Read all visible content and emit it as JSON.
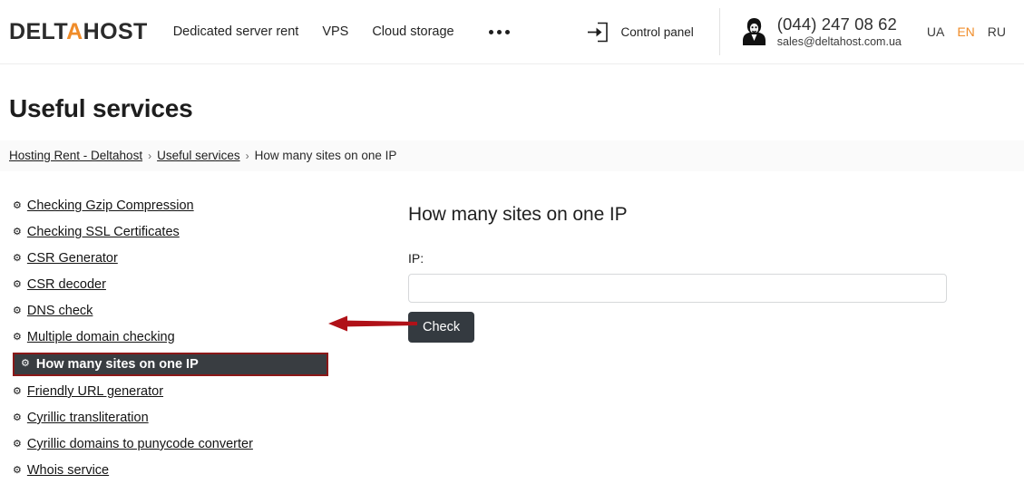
{
  "header": {
    "logo": {
      "part1": "DELT",
      "accent": "A",
      "part2": "HOST"
    },
    "nav": [
      {
        "label": "Dedicated server rent"
      },
      {
        "label": "VPS"
      },
      {
        "label": "Cloud storage"
      }
    ],
    "more_label": "...",
    "control_panel_label": "Control panel",
    "phone": "(044) 247 08 62",
    "email": "sales@deltahost.com.ua",
    "languages": [
      {
        "label": "UA",
        "active": false
      },
      {
        "label": "EN",
        "active": true
      },
      {
        "label": "RU",
        "active": false
      }
    ],
    "accent_color": "#f08c29"
  },
  "page": {
    "title": "Useful services"
  },
  "breadcrumb": {
    "items": [
      {
        "label": "Hosting Rent - Deltahost",
        "link": true
      },
      {
        "label": "Useful services",
        "link": true
      },
      {
        "label": "How many sites on one IP",
        "link": false
      }
    ],
    "separator": "›"
  },
  "sidebar": {
    "icon": "gear-icon",
    "items": [
      {
        "label": "Checking Gzip Compression",
        "active": false
      },
      {
        "label": "Checking SSL Certificates",
        "active": false
      },
      {
        "label": "CSR Generator",
        "active": false
      },
      {
        "label": "CSR decoder",
        "active": false
      },
      {
        "label": "DNS check",
        "active": false
      },
      {
        "label": "Multiple domain checking",
        "active": false
      },
      {
        "label": "How many sites on one IP",
        "active": true
      },
      {
        "label": "Friendly URL generator",
        "active": false
      },
      {
        "label": "Cyrillic transliteration",
        "active": false
      },
      {
        "label": "Cyrillic domains to punycode converter",
        "active": false
      },
      {
        "label": "Whois service",
        "active": false
      }
    ],
    "active_highlight_bg": "#393d41",
    "active_highlight_border": "#8b1818"
  },
  "annotation": {
    "arrow_color": "#b01118",
    "points_to": "How many sites on one IP"
  },
  "main": {
    "heading": "How many sites on one IP",
    "ip_label": "IP:",
    "ip_value": "",
    "ip_placeholder": "",
    "check_button": "Check",
    "button_color": "#343a40"
  }
}
